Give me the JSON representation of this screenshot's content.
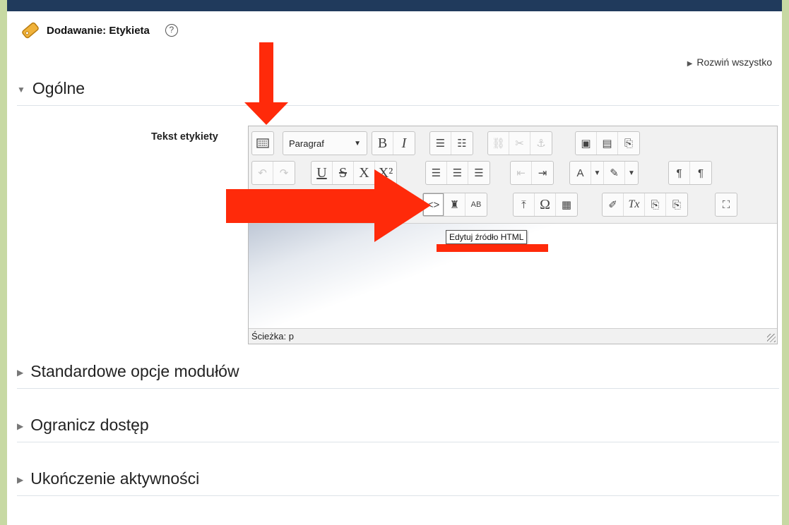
{
  "header": {
    "title": "Dodawanie: Etykieta",
    "help_icon": "?"
  },
  "expand_all": "Rozwiń wszystko",
  "sections": {
    "general": "Ogólne",
    "standard": "Standardowe opcje modułów",
    "restrict": "Ogranicz dostęp",
    "completion": "Ukończenie aktywności"
  },
  "field": {
    "label": "Tekst etykiety"
  },
  "editor": {
    "paragraph_select": "Paragraf",
    "tooltip": "Edytuj źródło HTML",
    "path": "Ścieżka: p",
    "glyphs": {
      "bold": "B",
      "italic": "I",
      "underline": "U",
      "strike": "S",
      "subscript": "X",
      "superscript": "X²",
      "omega": "Ω",
      "clear": "Tx",
      "html": "<>",
      "ltr": "¶",
      "rtl": "¶"
    }
  },
  "colors": {
    "arrow": "#ff2a0a",
    "topbar": "#203a5c",
    "background": "#c7d9a3"
  }
}
